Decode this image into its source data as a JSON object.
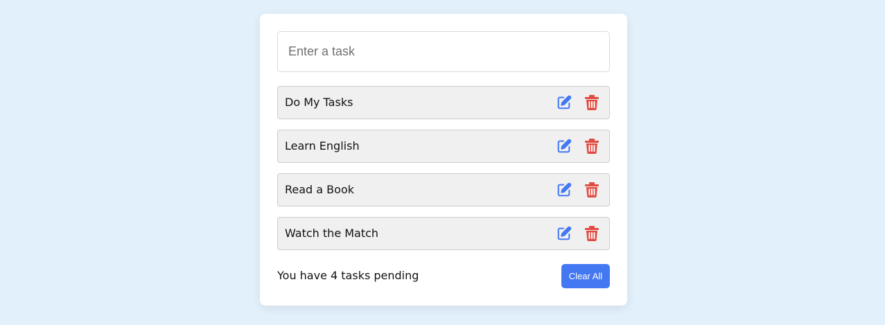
{
  "colors": {
    "page_background": "#e2f0fc",
    "card_background": "#ffffff",
    "edit_icon": "#4378f2",
    "delete_icon": "#e04b42",
    "button_accent": "#4378f2"
  },
  "input": {
    "placeholder": "Enter a task",
    "value": ""
  },
  "tasks": [
    {
      "text": "Do My Tasks",
      "edit_icon": "edit-icon",
      "delete_icon": "trash-icon"
    },
    {
      "text": "Learn English",
      "edit_icon": "edit-icon",
      "delete_icon": "trash-icon"
    },
    {
      "text": "Read a Book",
      "edit_icon": "edit-icon",
      "delete_icon": "trash-icon"
    },
    {
      "text": "Watch the Match",
      "edit_icon": "edit-icon",
      "delete_icon": "trash-icon"
    }
  ],
  "footer": {
    "pending_text": "You have 4 tasks pending",
    "clear_label": "Clear All"
  }
}
